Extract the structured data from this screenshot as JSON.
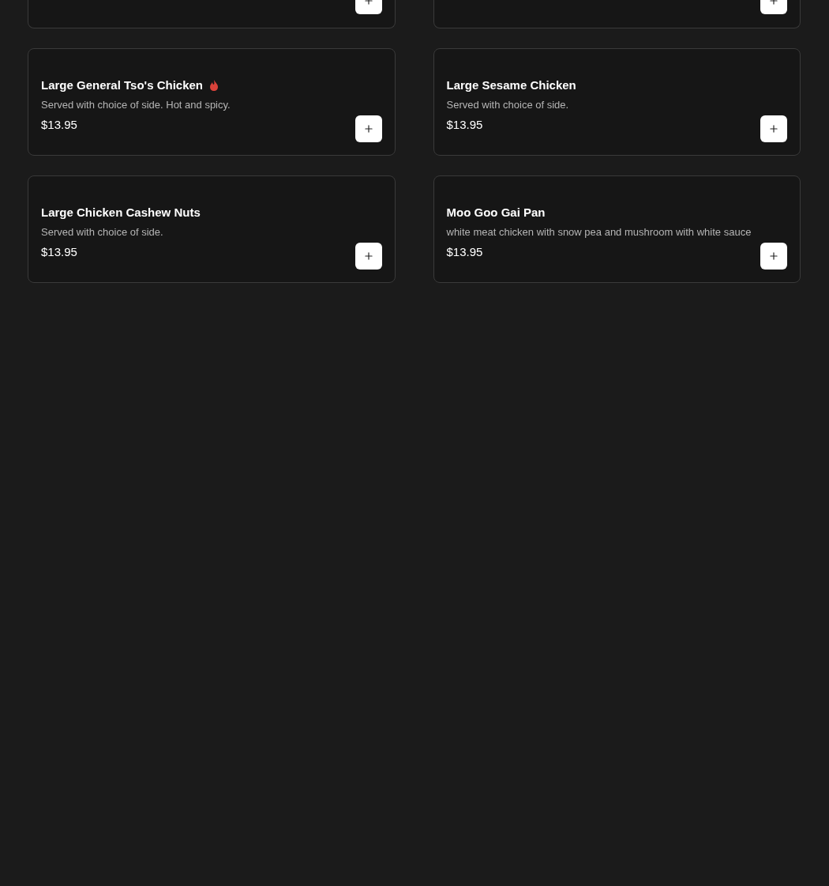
{
  "items": [
    {
      "kind": "cut-off"
    },
    {
      "kind": "cut-off"
    },
    {
      "kind": "full",
      "name": "Large General Tso's Chicken",
      "spicy": true,
      "description": "Served with choice of side. Hot and spicy.",
      "price": "$13.95"
    },
    {
      "kind": "full",
      "name": "Large Sesame Chicken",
      "spicy": false,
      "description": "Served with choice of side.",
      "price": "$13.95"
    },
    {
      "kind": "full",
      "name": "Large Chicken Cashew Nuts",
      "spicy": false,
      "description": "Served with choice of side.",
      "price": "$13.95"
    },
    {
      "kind": "full",
      "name": "Moo Goo Gai Pan",
      "spicy": false,
      "description": "white meat chicken with snow pea and mushroom with white sauce",
      "price": "$13.95"
    }
  ]
}
